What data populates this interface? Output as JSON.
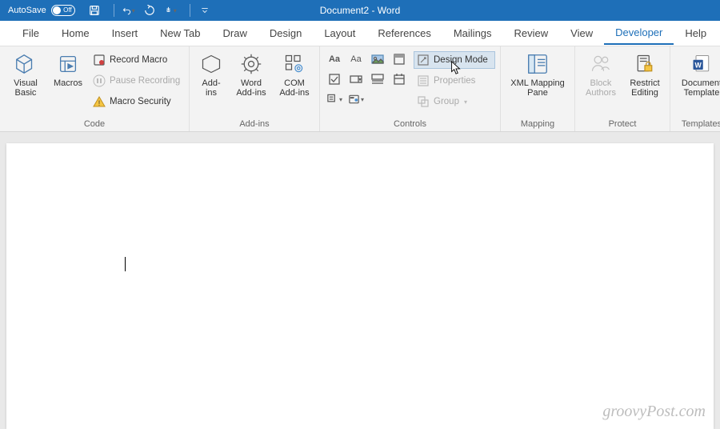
{
  "titlebar": {
    "autosave_label": "AutoSave",
    "autosave_state": "Off",
    "document_title": "Document2  -  Word"
  },
  "tabs": {
    "file": "File",
    "home": "Home",
    "insert": "Insert",
    "newtab": "New Tab",
    "draw": "Draw",
    "design": "Design",
    "layout": "Layout",
    "references": "References",
    "mailings": "Mailings",
    "review": "Review",
    "view": "View",
    "developer": "Developer",
    "help": "Help"
  },
  "ribbon": {
    "code": {
      "visual_basic": "Visual\nBasic",
      "macros": "Macros",
      "record_macro": "Record Macro",
      "pause_recording": "Pause Recording",
      "macro_security": "Macro Security",
      "group": "Code"
    },
    "addins": {
      "addins": "Add-\nins",
      "word_addins": "Word\nAdd-ins",
      "com_addins": "COM\nAdd-ins",
      "group": "Add-ins"
    },
    "controls": {
      "design_mode": "Design Mode",
      "properties": "Properties",
      "group_btn": "Group",
      "group": "Controls"
    },
    "mapping": {
      "xml_mapping": "XML Mapping\nPane",
      "group": "Mapping"
    },
    "protect": {
      "block_authors": "Block\nAuthors",
      "restrict_editing": "Restrict\nEditing",
      "group": "Protect"
    },
    "templates": {
      "doc_template": "Document\nTemplate",
      "group": "Templates"
    }
  },
  "watermark": "groovyPost.com"
}
